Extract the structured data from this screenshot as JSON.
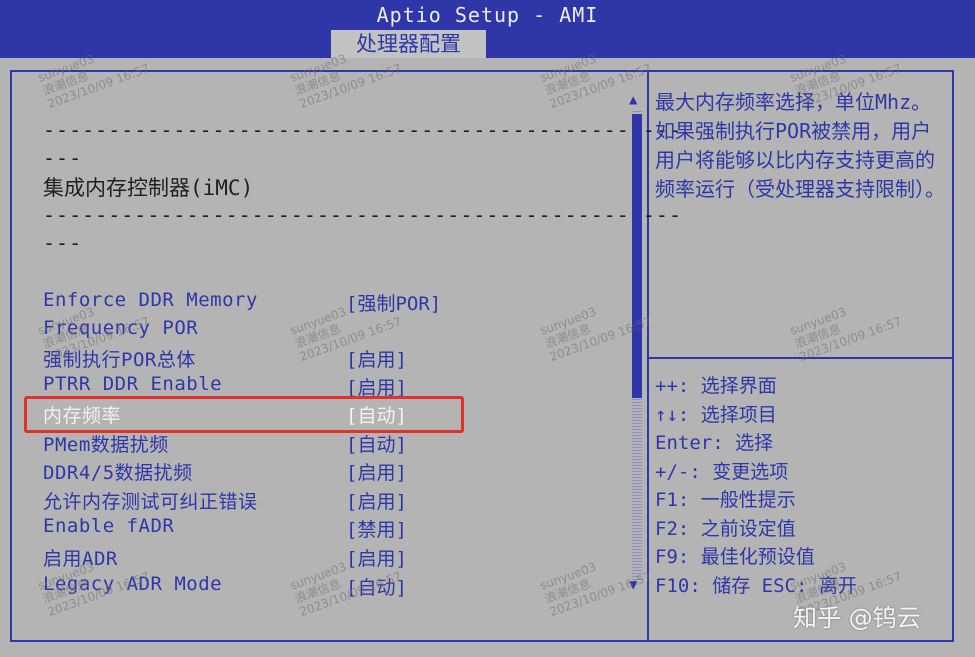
{
  "header": {
    "title": "Aptio Setup - AMI",
    "active_tab": "处理器配置"
  },
  "main": {
    "dashes_line": "-------------------------------------------------",
    "dashes_cont": "---",
    "section_title": "集成内存控制器(iMC)",
    "items": [
      {
        "label": "Enforce DDR Memory",
        "value": "[强制POR]"
      },
      {
        "label": "Frequency POR",
        "value": ""
      },
      {
        "label": "强制执行POR总体",
        "value": "[启用]"
      },
      {
        "label": "PTRR DDR Enable",
        "value": "[启用]"
      },
      {
        "label": "内存频率",
        "value": "[自动]"
      },
      {
        "label": "PMem数据扰频",
        "value": "[自动]"
      },
      {
        "label": "DDR4/5数据扰频",
        "value": "[启用]"
      },
      {
        "label": "允许内存测试可纠正错误",
        "value": "[启用]"
      },
      {
        "label": "Enable fADR",
        "value": "[禁用]"
      },
      {
        "label": "启用ADR",
        "value": "[启用]"
      },
      {
        "label": "Legacy ADR Mode",
        "value": "[自动]"
      }
    ]
  },
  "help": {
    "text": "最大内存频率选择，单位Mhz。如果强制执行POR被禁用，用户用户将能够以比内存支持更高的频率运行（受处理器支持限制）。",
    "keys": [
      "++: 选择界面",
      "↑↓: 选择项目",
      "Enter: 选择",
      "+/-: 变更选项",
      "F1: 一般性提示",
      "F2: 之前设定值",
      "F9: 最佳化预设值",
      "F10: 储存  ESC: 离开"
    ]
  },
  "scrollbar": {
    "up_arrow": "▲",
    "down_arrow": "▼"
  },
  "watermark": {
    "user": "sunyue03",
    "company": "浪潮信息",
    "timestamp": "2023/10/09 16:57"
  },
  "brand": "知乎 @钨云",
  "colors": {
    "background": "#b4b4b4",
    "bios_blue": "#2f37a8",
    "selected_text": "#f2f2f2",
    "highlight_box": "#e0312c"
  }
}
